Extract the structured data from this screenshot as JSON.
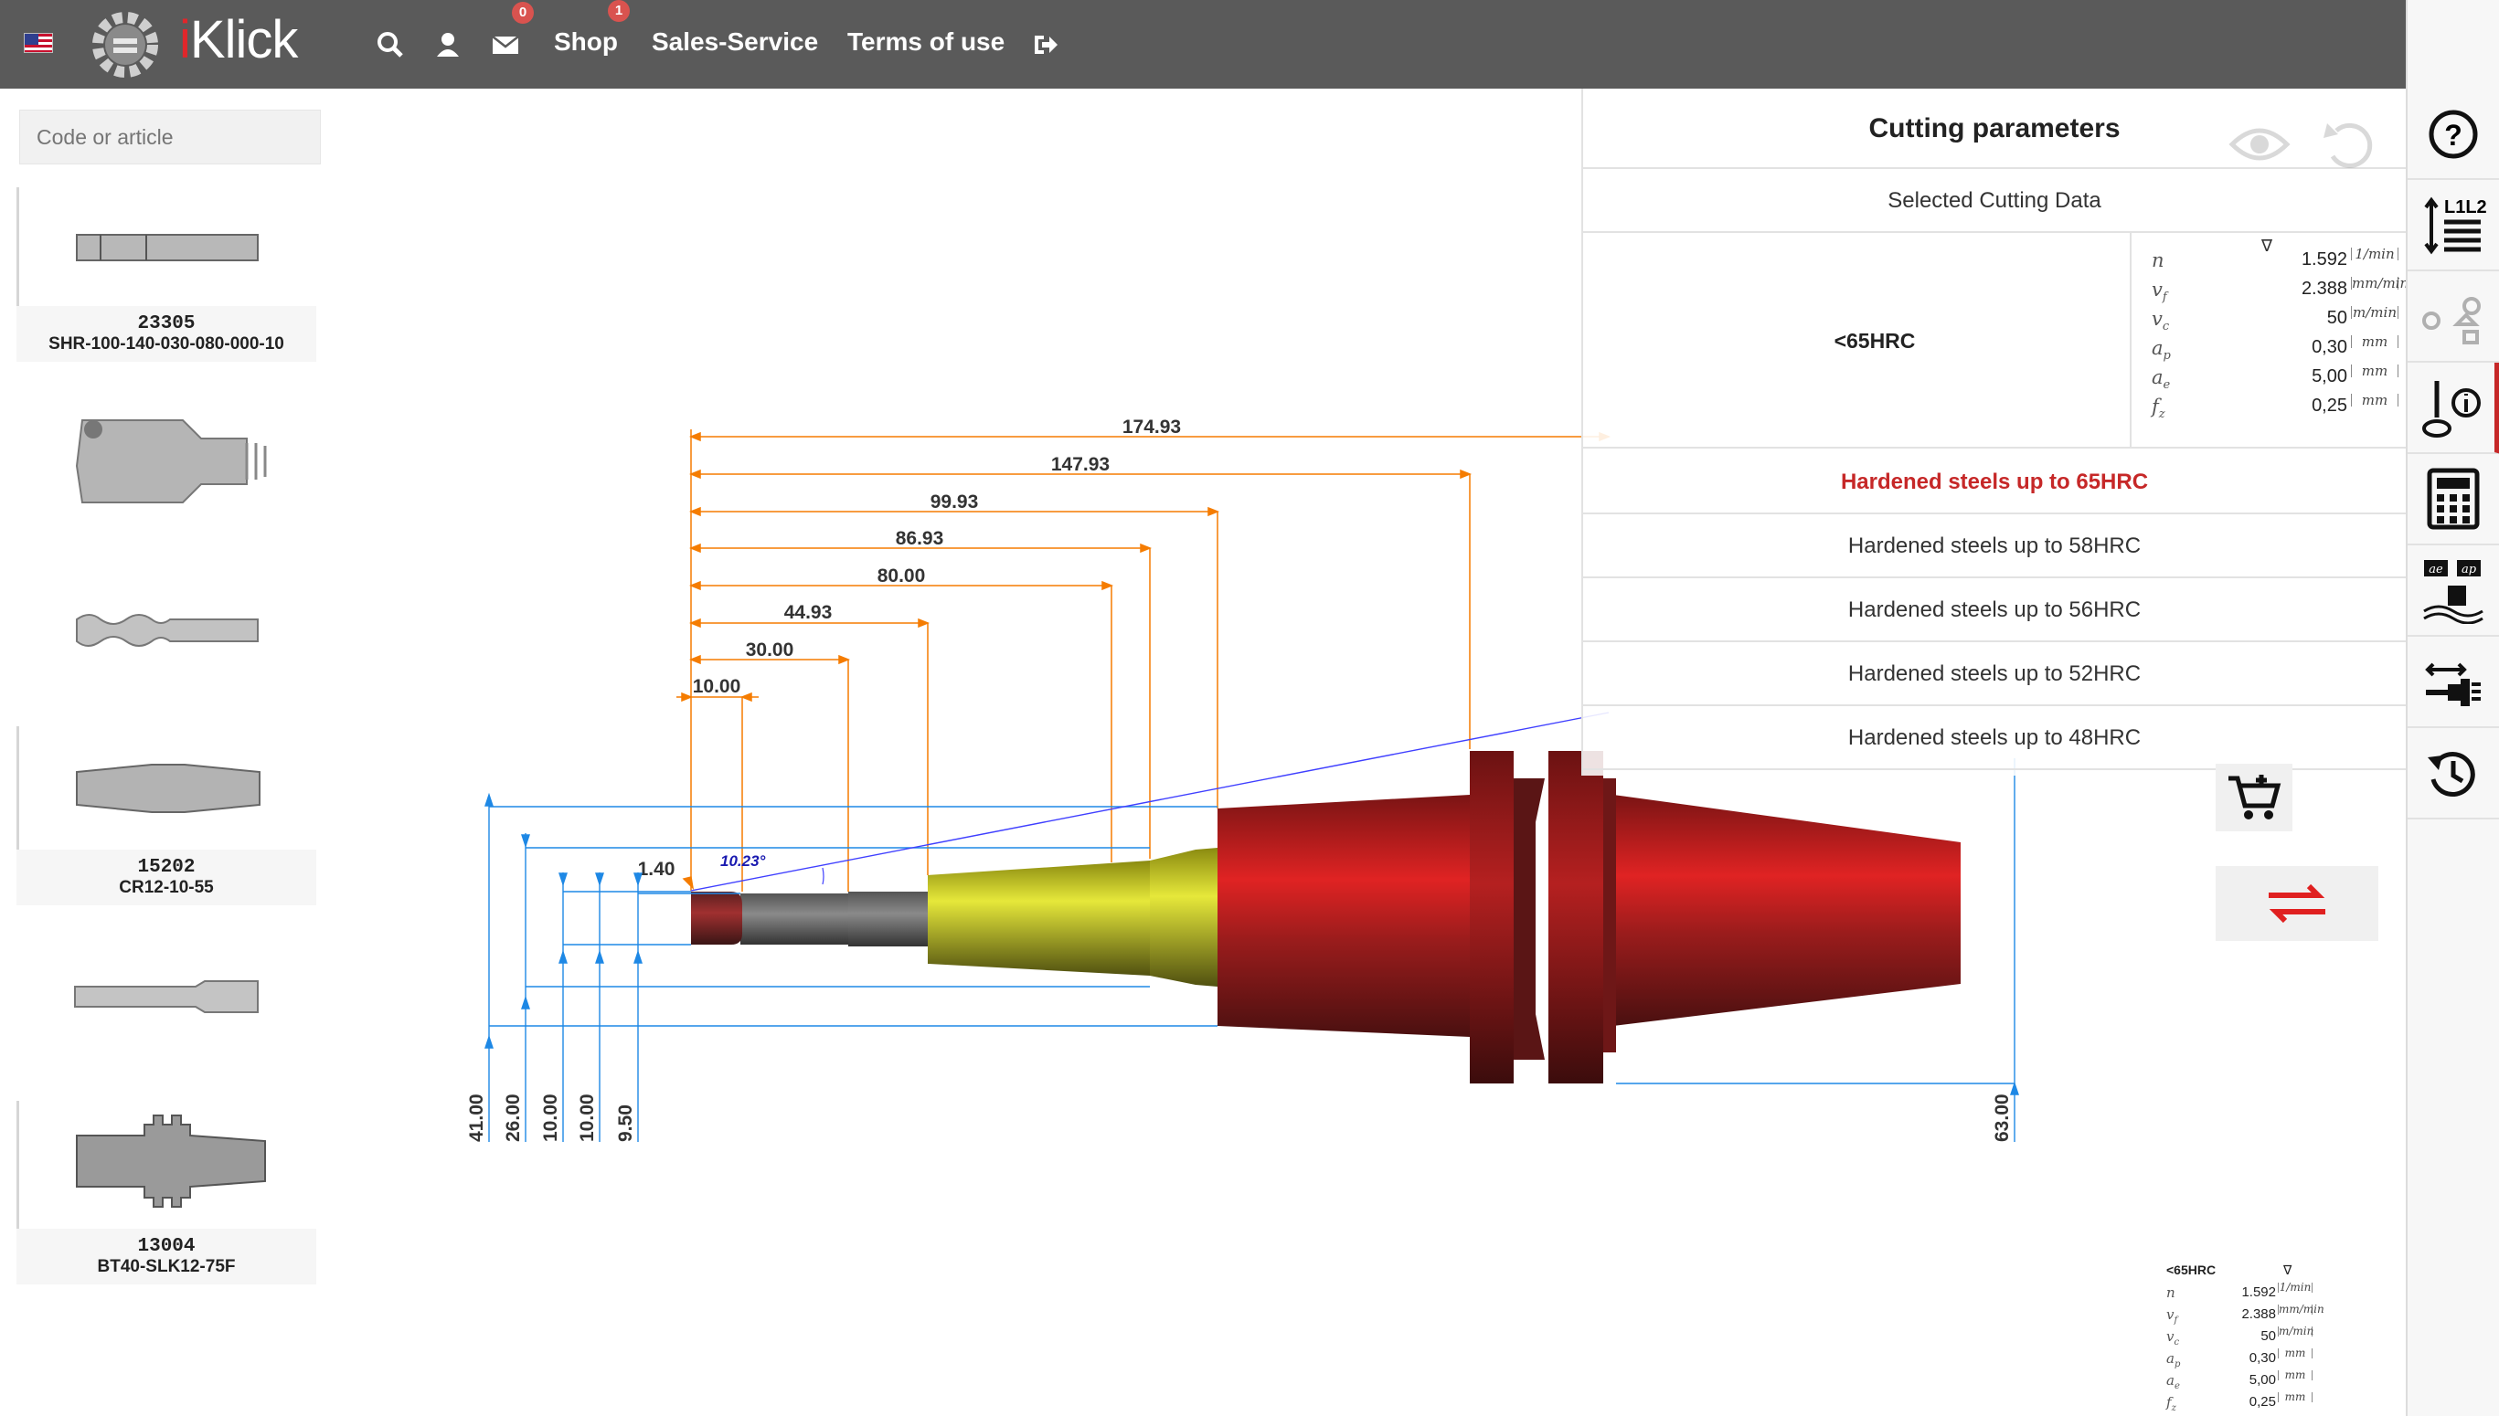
{
  "header": {
    "logo_prefix": "i",
    "logo_main": "Klick",
    "messages_badge": "0",
    "cart_badge": "1",
    "nav_links": [
      "Shop",
      "Sales-Service",
      "Terms of use"
    ]
  },
  "search": {
    "placeholder": "Code or article"
  },
  "items": [
    {
      "code": "23305",
      "name": "SHR-100-140-030-080-000-10"
    },
    {
      "code": "",
      "name": ""
    },
    {
      "code": "",
      "name": ""
    },
    {
      "code": "15202",
      "name": "CR12-10-55"
    },
    {
      "code": "",
      "name": ""
    },
    {
      "code": "13004",
      "name": "BT40-SLK12-75F"
    }
  ],
  "drawing": {
    "lengths": [
      "174.93",
      "147.93",
      "99.93",
      "86.93",
      "80.00",
      "44.93",
      "30.00",
      "10.00"
    ],
    "diameters": [
      "41.00",
      "26.00",
      "10.00",
      "10.00",
      "9.50"
    ],
    "overall_diameter": "63.00",
    "tip_length": "1.40",
    "angle": "10.23°"
  },
  "panel": {
    "title": "Cutting parameters",
    "subtitle": "Selected Cutting Data",
    "condition": "<65HRC",
    "triangle": "∇",
    "params": [
      {
        "sym": "n",
        "sub": "",
        "val": "1.592",
        "unit": "1/min"
      },
      {
        "sym": "v",
        "sub": "f",
        "val": "2.388",
        "unit": "mm/min"
      },
      {
        "sym": "v",
        "sub": "c",
        "val": "50",
        "unit": "m/min"
      },
      {
        "sym": "a",
        "sub": "p",
        "val": "0,30",
        "unit": "mm"
      },
      {
        "sym": "a",
        "sub": "e",
        "val": "5,00",
        "unit": "mm"
      },
      {
        "sym": "f",
        "sub": "z",
        "val": "0,25",
        "unit": "mm"
      }
    ],
    "materials": [
      "Hardened steels up to 65HRC",
      "Hardened steels up to 58HRC",
      "Hardened steels up to 56HRC",
      "Hardened steels up to 52HRC",
      "Hardened steels up to 48HRC"
    ]
  },
  "colors": {
    "topbar": "#5a5a5a",
    "accent": "#c62828",
    "dimension": "#f57c00",
    "dim_blue": "#1e88e5"
  },
  "rail_icons": [
    "help-icon",
    "length-list-icon",
    "assembly-icon",
    "tool-info-icon",
    "calculator-icon",
    "ae-ap-icon",
    "connection-icon",
    "history-icon"
  ]
}
